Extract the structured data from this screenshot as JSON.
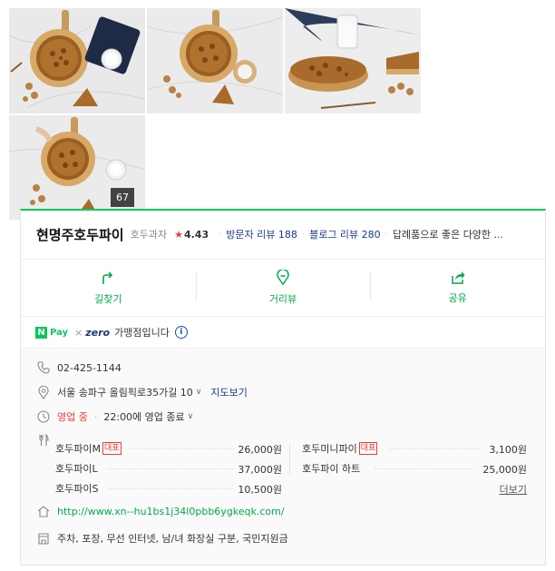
{
  "photos": {
    "count": "67"
  },
  "place": {
    "name": "현명주호두파이",
    "category": "호두과자",
    "rating": "4.43",
    "visitor_reviews": "방문자 리뷰 188",
    "blog_reviews": "블로그 리뷰 280",
    "description": "답례품으로 좋은 다양한 ..."
  },
  "actions": [
    {
      "label": "길찾기",
      "icon": "directions-icon"
    },
    {
      "label": "거리뷰",
      "icon": "street-view-icon"
    },
    {
      "label": "공유",
      "icon": "share-icon"
    }
  ],
  "pay": {
    "n": "N",
    "pay": "Pay",
    "x": "×",
    "zero": "zero",
    "text": "가맹점입니다",
    "info": "i"
  },
  "details": {
    "phone": "02-425-1144",
    "address": "서울 송파구 올림픽로35가길 10",
    "map_link": "지도보기",
    "status": "영업 중",
    "hours": "22:00에 영업 종료",
    "url": "http://www.xn--hu1bs1j34l0pbb6ygkeqk.com/",
    "amenities": "주차, 포장, 무선 인터넷, 남/녀 화장실 구분, 국민지원금"
  },
  "menu": {
    "tag": "대표",
    "more": "더보기",
    "items": [
      {
        "name": "호두파이M",
        "price": "26,000원",
        "signature": true
      },
      {
        "name": "호두미니파이",
        "price": "3,100원",
        "signature": true
      },
      {
        "name": "호두파이L",
        "price": "37,000원",
        "signature": false
      },
      {
        "name": "호두파이 하트",
        "price": "25,000원",
        "signature": false
      },
      {
        "name": "호두파이S",
        "price": "10,500원",
        "signature": false
      }
    ]
  },
  "colors": {
    "accent": "#03c75a",
    "link": "#1a3a8c",
    "open": "#e34040"
  }
}
